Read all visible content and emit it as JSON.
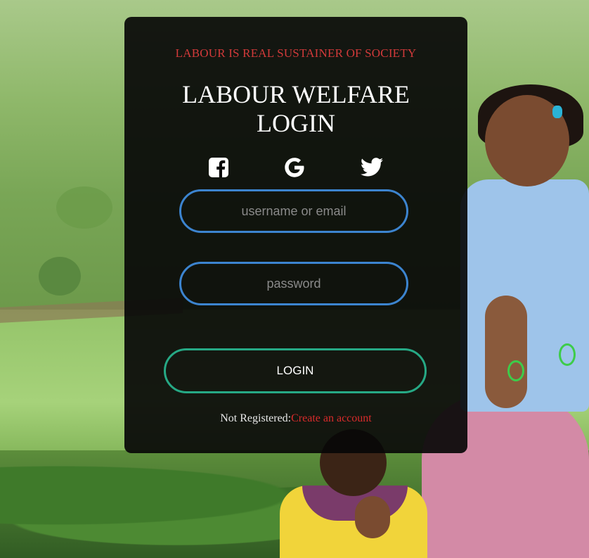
{
  "card": {
    "tagline": "LABOUR IS REAL SUSTAINER OF SOCIETY",
    "title_line1": "LABOUR WELFARE",
    "title_line2": "LOGIN"
  },
  "social": [
    {
      "icon": "facebook-icon"
    },
    {
      "icon": "google-icon"
    },
    {
      "icon": "twitter-icon"
    }
  ],
  "form": {
    "username_placeholder": "username or email",
    "password_placeholder": "password",
    "login_label": "LOGIN"
  },
  "register": {
    "prompt": "Not Registered:",
    "link_label": "Create an account"
  },
  "colors": {
    "tagline": "#d23a3a",
    "input_border": "#3c84cf",
    "button_border": "#26a985",
    "link": "#d92b2b"
  }
}
